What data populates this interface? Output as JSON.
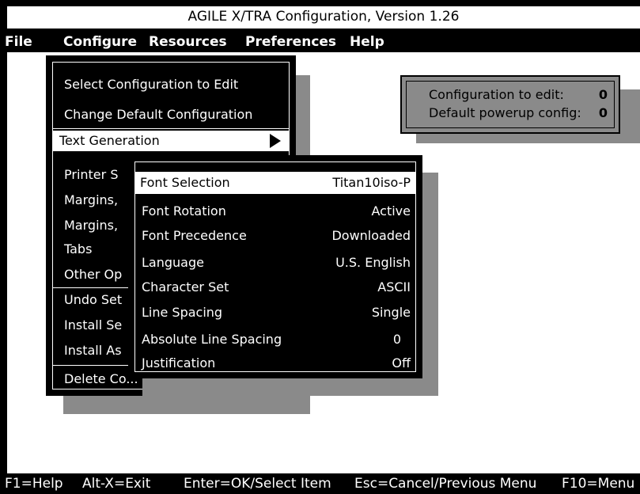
{
  "window": {
    "title": "AGILE X/TRA Configuration, Version 1.26"
  },
  "menubar": [
    "File",
    "Configure",
    "Resources",
    "Preferences",
    "Help"
  ],
  "configure_menu": {
    "items": [
      "Select Configuration to Edit",
      "Change Default Configuration",
      "Text Generation",
      "Printer S",
      "Margins,",
      "Margins,",
      "Tabs",
      "Other Op",
      "Undo Set",
      "Install Se",
      "Install As",
      "Delete Co..."
    ]
  },
  "text_generation_menu": {
    "items": [
      {
        "label": "Font Selection",
        "value": "Titan10iso-P"
      },
      {
        "label": "Font Rotation",
        "value": "Active"
      },
      {
        "label": "Font Precedence",
        "value": "Downloaded"
      },
      {
        "label": "Language",
        "value": "U.S. English"
      },
      {
        "label": "Character Set",
        "value": "ASCII"
      },
      {
        "label": "Line Spacing",
        "value": "Single"
      },
      {
        "label": "Absolute Line Spacing",
        "value": "0"
      },
      {
        "label": "Justification",
        "value": "Off"
      }
    ]
  },
  "info": {
    "edit_label": "Configuration to edit:",
    "edit_value": "0",
    "default_label": "Default powerup config:",
    "default_value": "0"
  },
  "statusbar": [
    "F1=Help",
    "Alt-X=Exit",
    "Enter=OK/Select Item",
    "Esc=Cancel/Previous Menu",
    "F10=Menu"
  ],
  "colors": {
    "background": "#ffffff",
    "menu": "#000000",
    "shadow": "#8a8a8a"
  }
}
